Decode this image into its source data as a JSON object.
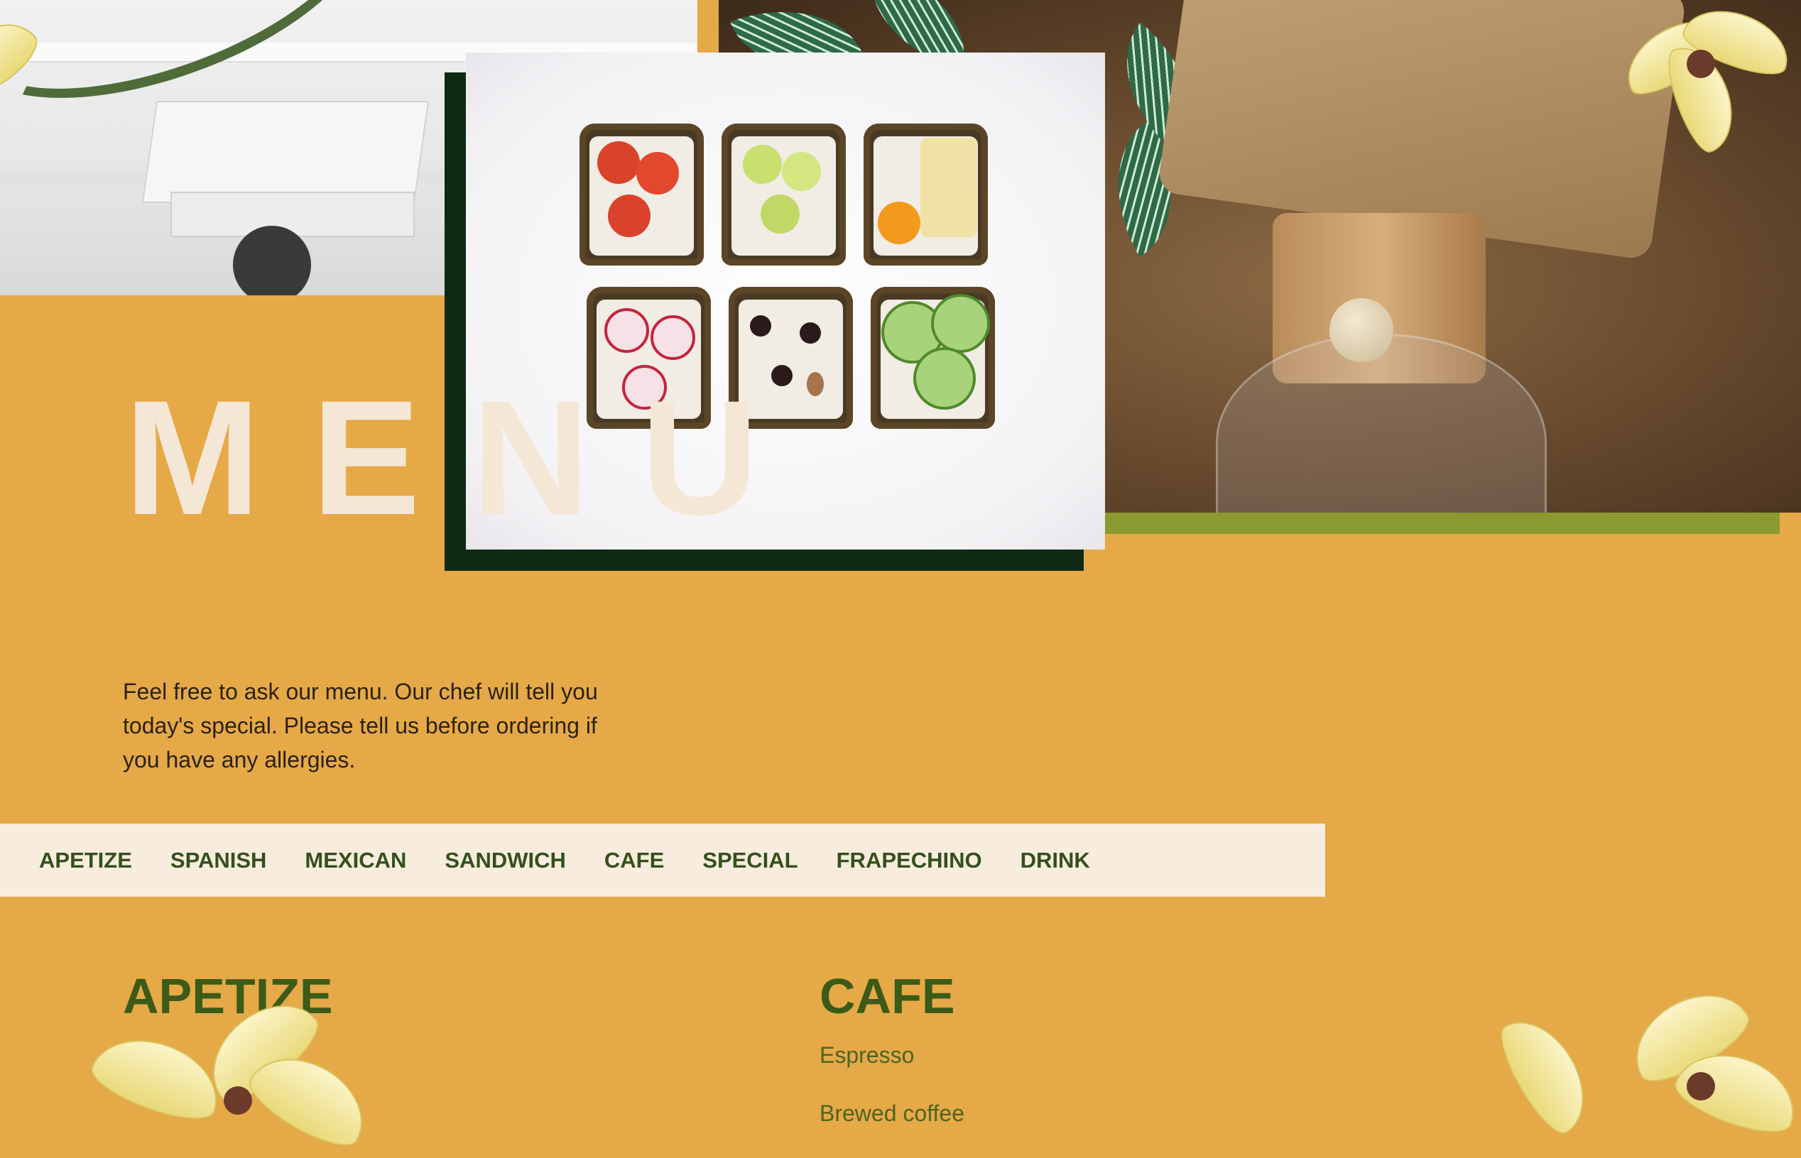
{
  "hero": {
    "title": "MENU",
    "intro": "Feel free to ask our menu. Our chef will tell you today's special. Please tell us before ordering if you have any allergies."
  },
  "tabs": [
    {
      "id": "apetize",
      "label": "APETIZE"
    },
    {
      "id": "spanish",
      "label": "SPANISH"
    },
    {
      "id": "mexican",
      "label": "MEXICAN"
    },
    {
      "id": "sandwich",
      "label": "SANDWICH"
    },
    {
      "id": "cafe",
      "label": "CAFE"
    },
    {
      "id": "special",
      "label": "SPECIAL"
    },
    {
      "id": "frapechino",
      "label": "FRAPECHINO"
    },
    {
      "id": "drink",
      "label": "DRINK"
    }
  ],
  "sections": {
    "apetize": {
      "title": "APETIZE"
    },
    "cafe": {
      "title": "CAFE",
      "items": [
        "Espresso",
        "Brewed coffee"
      ]
    }
  },
  "colors": {
    "background": "#e6a947",
    "title_text": "#f5e7d6",
    "tab_bar": "#f7ecdd",
    "tab_text": "#34501b",
    "heading_green": "#3b5b17",
    "olive_bar": "#8a9a2f",
    "dark_frame": "#0e2a12"
  }
}
